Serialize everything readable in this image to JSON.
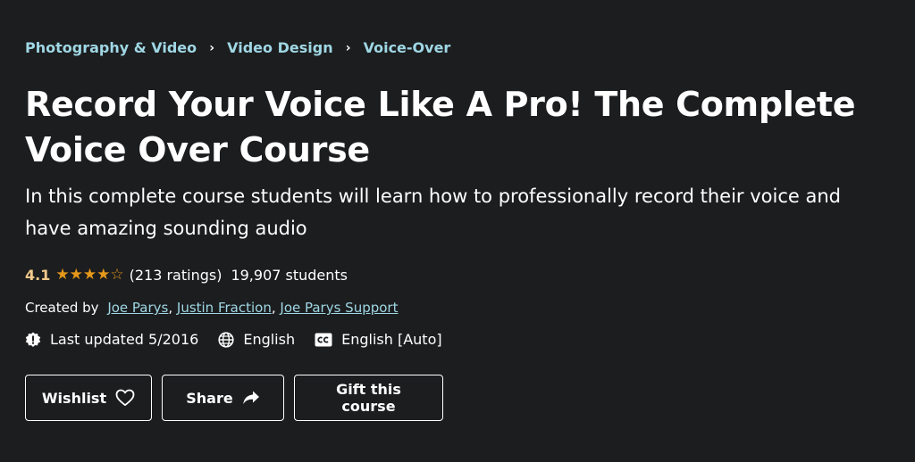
{
  "breadcrumb": {
    "items": [
      {
        "label": "Photography & Video"
      },
      {
        "label": "Video Design"
      },
      {
        "label": "Voice-Over"
      }
    ],
    "separator": "›"
  },
  "course": {
    "title": "Record Your Voice Like A Pro! The Complete Voice Over Course",
    "subtitle": "In this complete course students will learn how to professionally record their voice and have amazing sounding audio"
  },
  "rating": {
    "value": "4.1",
    "stars_filled": 4,
    "stars_total": 5,
    "ratings_count": "(213 ratings)",
    "students": "19,907 students"
  },
  "created_by": {
    "label": "Created by",
    "authors": [
      "Joe Parys",
      "Justin Fraction",
      "Joe Parys Support"
    ]
  },
  "meta": {
    "last_updated": "Last updated 5/2016",
    "language": "English",
    "captions": "English [Auto]"
  },
  "buttons": {
    "wishlist": "Wishlist",
    "share": "Share",
    "gift": "Gift this course"
  },
  "colors": {
    "background": "#1c1d1f",
    "breadcrumb": "#9fd7e4",
    "rating": "#f3ca8c",
    "stars": "#e59819",
    "link": "#c0c4fc"
  },
  "icons": {
    "wishlist": "heart-icon",
    "share": "share-arrow-icon",
    "last_updated": "alert-badge-icon",
    "language": "globe-icon",
    "captions": "closed-captions-icon"
  }
}
